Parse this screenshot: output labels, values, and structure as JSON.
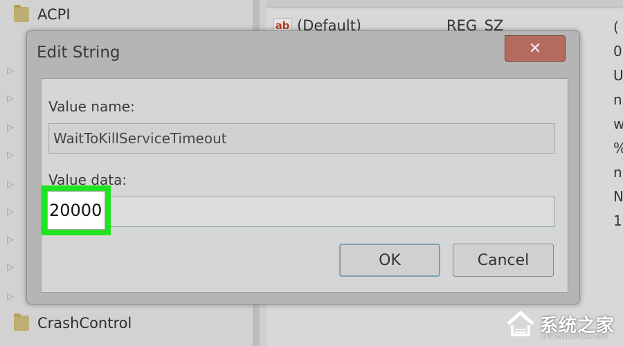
{
  "tree": {
    "items": [
      {
        "label": "ACPI"
      },
      {
        "label": "CrashControl"
      }
    ]
  },
  "list": {
    "rows": [
      {
        "name": "(Default)",
        "type": "REG_SZ"
      }
    ],
    "right_column_letters": [
      "(",
      "0",
      "U",
      "n",
      "w",
      "%",
      "n",
      "N",
      "1"
    ]
  },
  "dialog": {
    "title": "Edit String",
    "close_glyph": "✕",
    "value_name_label": "Value name:",
    "value_name": "WaitToKillServiceTimeout",
    "value_data_label": "Value data:",
    "value_data": "20000",
    "ok_label": "OK",
    "cancel_label": "Cancel"
  },
  "colors": {
    "highlight": "#22e322"
  },
  "watermark": {
    "text": "系统之家",
    "subtext": "XITONGZHIJIA.NET"
  }
}
